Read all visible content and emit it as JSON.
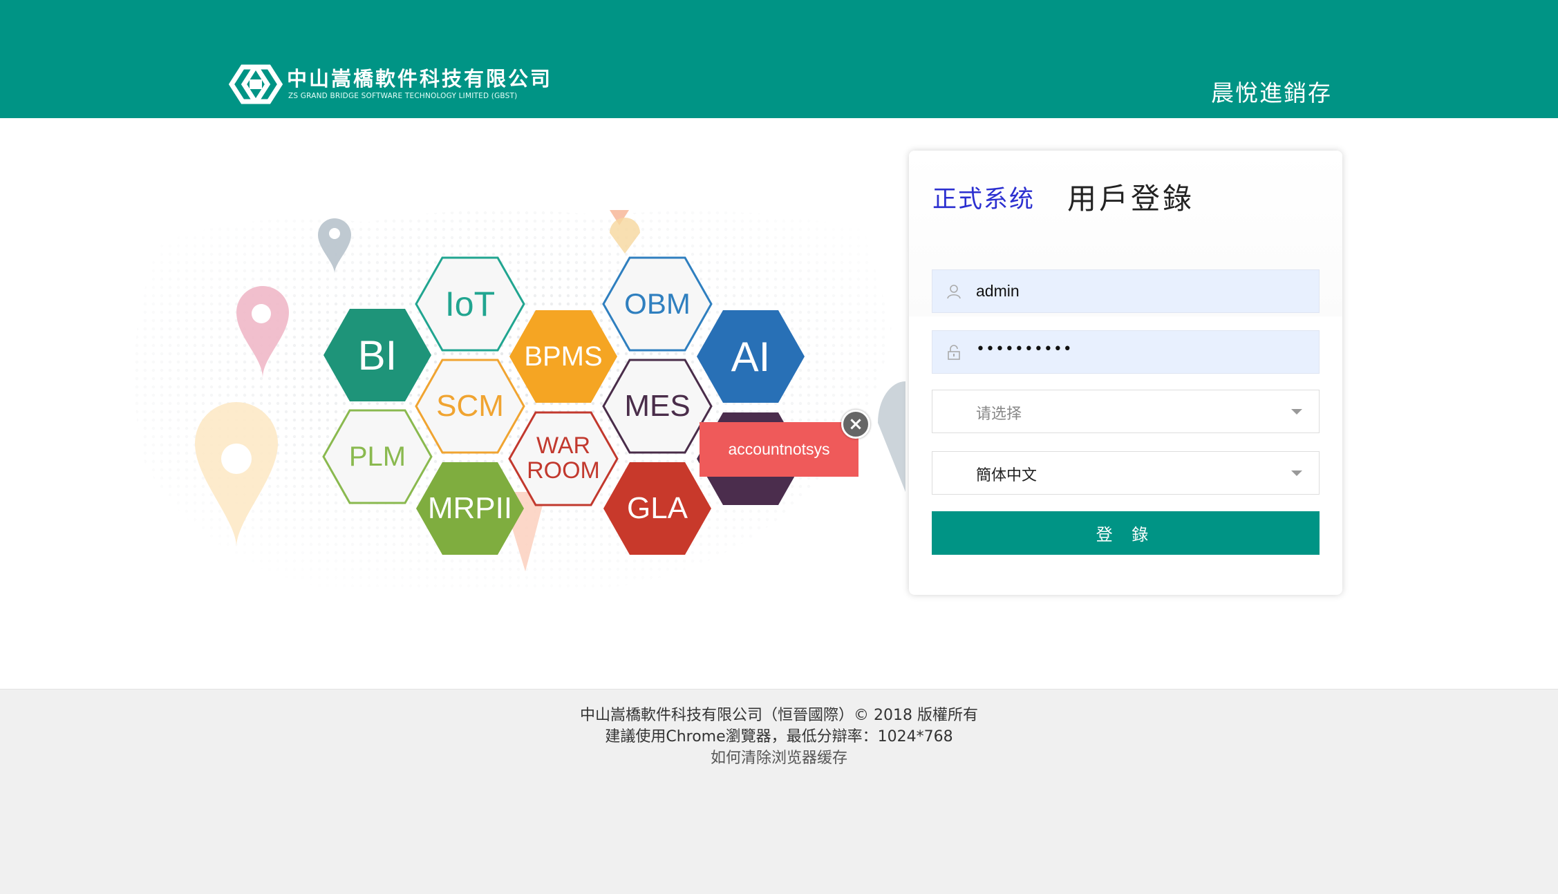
{
  "header": {
    "company_name": "中山嵩橋軟件科技有限公司",
    "company_name_en": "ZS GRAND BRIDGE SOFTWARE TECHNOLOGY LIMITED (GBST)",
    "system_name": "晨悅進銷存"
  },
  "banner": {
    "hexes": [
      "BI",
      "IoT",
      "BPMS",
      "OBM",
      "AI",
      "SCM",
      "MES",
      "PLM",
      "WAR ROOM",
      "MRPII",
      "GLA"
    ],
    "colors": {
      "BI": "#1e9479",
      "BPMS": "#f5a523",
      "AI": "#2870b6",
      "MRPII": "#7fad3f",
      "GLA": "#c8392b",
      "dark": "#4b2d4d",
      "IoT": "#21a590",
      "OBM": "#2f7fbf",
      "SCM": "#f0a431",
      "MES": "#4a2d4a",
      "PLM": "#8ab94f",
      "WAR ROOM": "#c2392e"
    }
  },
  "error_tooltip": {
    "message": "accountnotsys"
  },
  "login": {
    "system_tag": "正式系统",
    "title": "用戶登錄",
    "username": "admin",
    "password_mask": "••••••••••",
    "account_select_placeholder": "请选择",
    "language_selected": "簡体中文",
    "submit_label": "登 錄"
  },
  "footer": {
    "line1": "中山嵩橋軟件科技有限公司（恒晉國際）© 2018 版權所有",
    "line2": "建議使用Chrome瀏覽器，最低分辯率：1024*768",
    "line3": "如何清除浏览器缓存"
  }
}
